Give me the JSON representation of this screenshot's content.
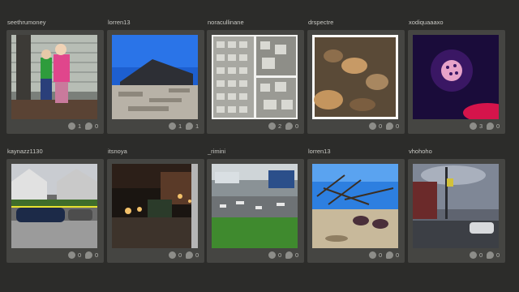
{
  "cards": [
    {
      "username": "seethrumoney",
      "likes": "1",
      "comments": "0"
    },
    {
      "username": "lorren13",
      "likes": "1",
      "comments": "1"
    },
    {
      "username": "noracullinane",
      "likes": "2",
      "comments": "0"
    },
    {
      "username": "drspectre",
      "likes": "0",
      "comments": "0"
    },
    {
      "username": "xodiquaaaxo",
      "likes": "3",
      "comments": "0"
    },
    {
      "username": "kaynazz1130",
      "likes": "0",
      "comments": "0"
    },
    {
      "username": "itsnoya",
      "likes": "0",
      "comments": "0"
    },
    {
      "username": "_rimini",
      "likes": "0",
      "comments": "0"
    },
    {
      "username": "lorren13",
      "likes": "0",
      "comments": "0"
    },
    {
      "username": "vhohoho",
      "likes": "0",
      "comments": "0"
    }
  ],
  "icons": {
    "like": "heart-icon",
    "comment": "comment-bubble-icon"
  },
  "colors": {
    "background": "#2c2c2a",
    "panel": "#454542",
    "text": "#c9c9c4"
  }
}
